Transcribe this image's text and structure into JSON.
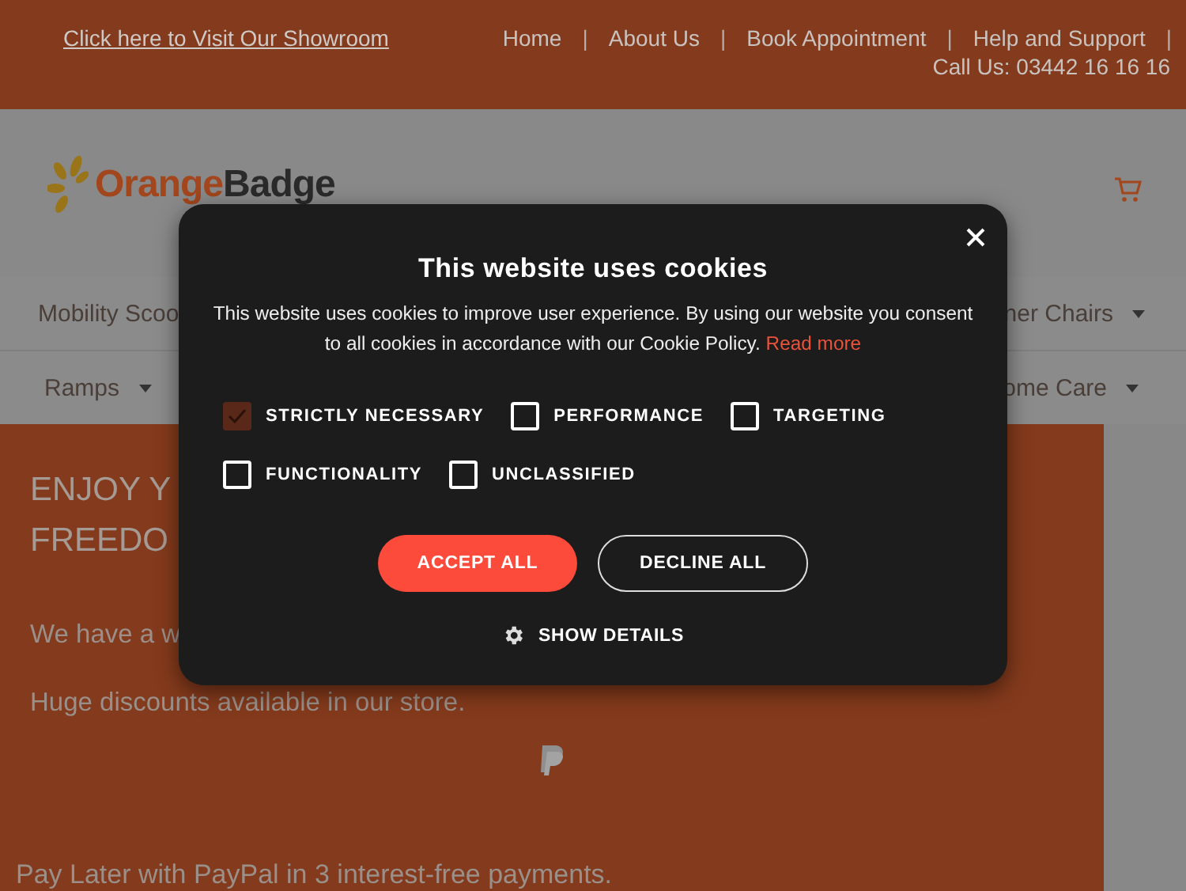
{
  "top_bar": {
    "showroom_link": "Click here to Visit Our Showroom",
    "items": [
      {
        "kind": "link",
        "text": "Home"
      },
      {
        "kind": "separator",
        "text": "|"
      },
      {
        "kind": "link",
        "text": "About Us"
      },
      {
        "kind": "separator",
        "text": "|"
      },
      {
        "kind": "link",
        "text": "Book Appointment"
      },
      {
        "kind": "separator",
        "text": "|"
      },
      {
        "kind": "link",
        "text": "Help and Support"
      },
      {
        "kind": "separator",
        "text": "|"
      }
    ],
    "phone": "Call Us: 03442 16 16 16"
  },
  "header": {
    "logo": {
      "part_1": "Orange",
      "part_2": "Badge"
    }
  },
  "nav": {
    "rows": [
      {
        "items": [
          {
            "label": "Mobility Scoo"
          },
          {
            "label": "ner Chairs",
            "dropdown": true
          }
        ]
      },
      {
        "items": [
          {
            "label": "Ramps",
            "dropdown": true
          },
          {
            "label": "ome Care",
            "dropdown": true
          }
        ]
      }
    ]
  },
  "hero": {
    "heading_lines": [
      "ENJOY Y",
      "FREEDO"
    ],
    "lines": [
      "We have a w",
      "Huge discounts available in our store."
    ],
    "paypal_note": "Pay Later with PayPal in 3 interest-free payments."
  },
  "cookie_dialog": {
    "title": "This website uses cookies",
    "text": "This website uses cookies to improve user experience. By using our website you consent to all cookies in accordance with our Cookie Policy.",
    "link": "Read more",
    "categories": [
      {
        "label": "STRICTLY NECESSARY",
        "checked": true
      },
      {
        "label": "PERFORMANCE",
        "checked": false
      },
      {
        "label": "TARGETING",
        "checked": false
      },
      {
        "label": "FUNCTIONALITY",
        "checked": false
      },
      {
        "label": "UNCLASSIFIED",
        "checked": false
      }
    ],
    "buttons": [
      {
        "label": "ACCEPT ALL",
        "kind": "primary"
      },
      {
        "label": "DECLINE ALL",
        "kind": "outline"
      }
    ],
    "details": "SHOW DETAILS"
  }
}
